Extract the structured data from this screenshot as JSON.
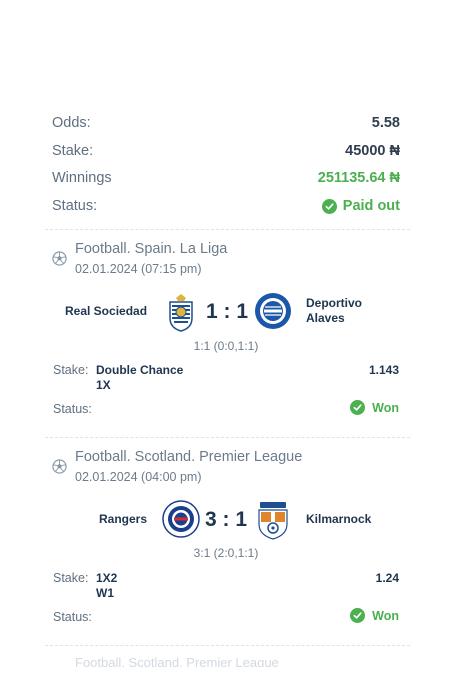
{
  "summary": {
    "odds_label": "Odds:",
    "odds_value": "5.58",
    "stake_label": "Stake:",
    "stake_value": "45000 ₦",
    "winnings_label": "Winnings",
    "winnings_value": "251135.64 ₦",
    "status_label": "Status:",
    "status_value": "Paid out"
  },
  "events": [
    {
      "league": "Football. Spain. La Liga",
      "date": "02.01.2024 (07:15 pm)",
      "home_team": "Real Sociedad",
      "away_team_line1": "Deportivo",
      "away_team_line2": "Alaves",
      "score": "1 : 1",
      "halves": "1:1 (0:0,1:1)",
      "stake_label": "Stake:",
      "market_line1": "Double Chance",
      "market_line2": "1X",
      "coefficient": "1.143",
      "status_label": "Status:",
      "status_value": "Won"
    },
    {
      "league": "Football. Scotland. Premier League",
      "date": "02.01.2024 (04:00 pm)",
      "home_team": "Rangers",
      "away_team": "Kilmarnock",
      "score": "3 : 1",
      "halves": "3:1 (2:0,1:1)",
      "stake_label": "Stake:",
      "market_line1": "1X2",
      "market_line2": "W1",
      "coefficient": "1.24",
      "status_label": "Status:",
      "status_value": "Won"
    }
  ],
  "next_event_league": "Football. Scotland. Premier League",
  "colors": {
    "green": "#4caf50",
    "navy": "#1f3550",
    "muted": "#5f6f80"
  }
}
